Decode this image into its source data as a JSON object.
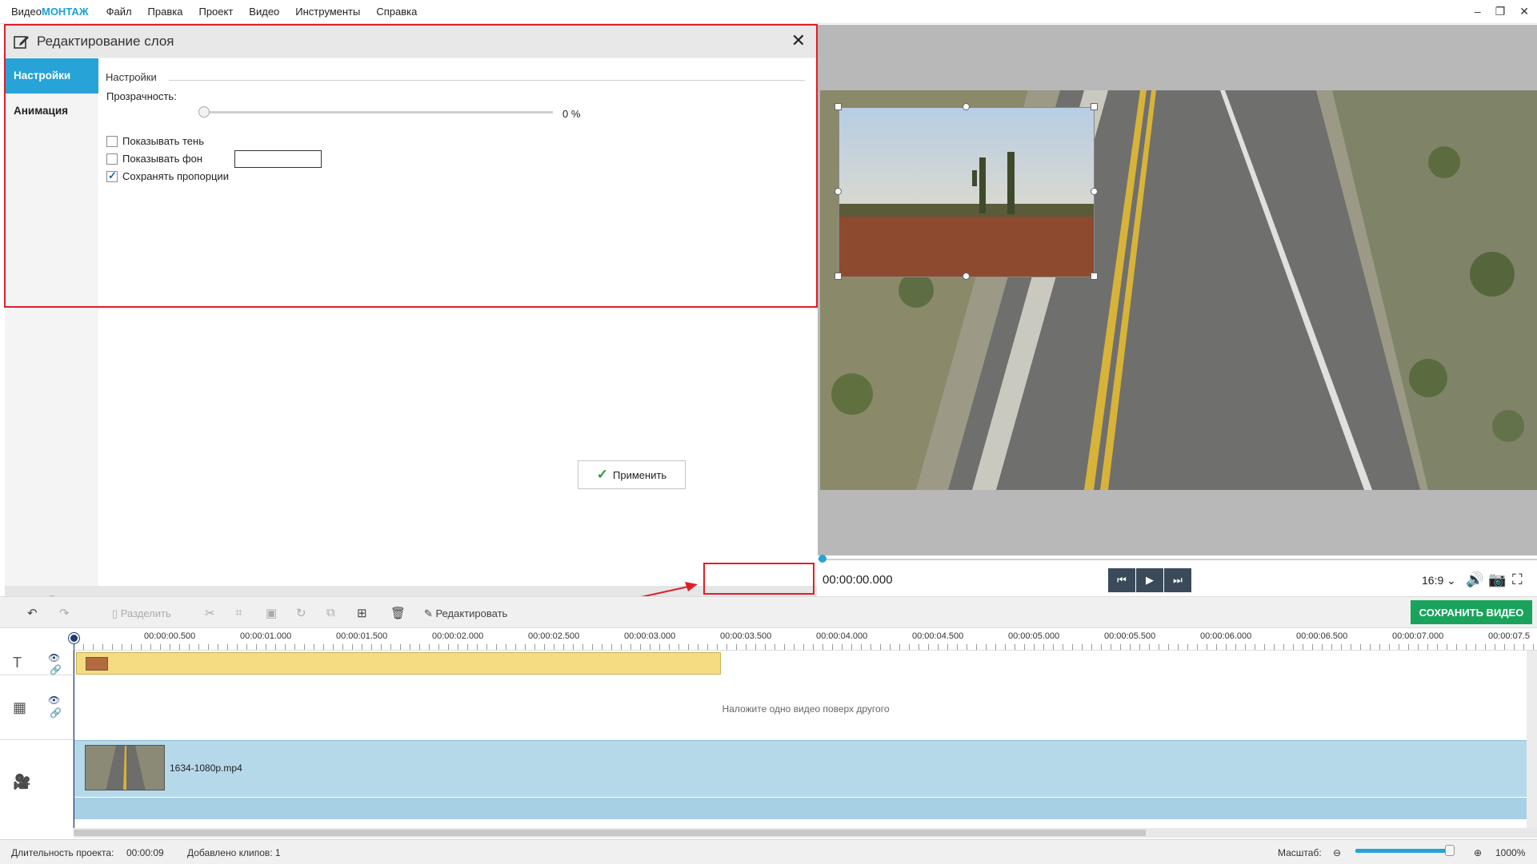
{
  "app": {
    "logo_prefix": "Видео",
    "logo_brand": "МОНТАЖ"
  },
  "menu": [
    "Файл",
    "Правка",
    "Проект",
    "Видео",
    "Инструменты",
    "Справка"
  ],
  "window_controls": [
    "minimize",
    "restore",
    "close"
  ],
  "editor": {
    "title": "Редактирование слоя",
    "tabs": [
      {
        "label": "Настройки",
        "active": true
      },
      {
        "label": "Анимация",
        "active": false
      }
    ],
    "section": "Настройки",
    "opacity_label": "Прозрачность:",
    "opacity_value": "0 %",
    "opacity_level": 0,
    "show_shadow": {
      "label": "Показывать тень",
      "checked": false
    },
    "show_background": {
      "label": "Показывать фон",
      "checked": false
    },
    "keep_proportions": {
      "label": "Сохранять пропорции",
      "checked": true
    },
    "apply_label": "Применить"
  },
  "player": {
    "timecode": "00:00:00.000",
    "aspect": "16:9 ⌄"
  },
  "toolbar": {
    "split_label": "Разделить",
    "edit_label": "Редактировать",
    "save_label": "СОХРАНИТЬ ВИДЕО"
  },
  "timeline": {
    "ticks": [
      "00:00:00.500",
      "00:00:01.000",
      "00:00:01.500",
      "00:00:02.000",
      "00:00:02.500",
      "00:00:03.000",
      "00:00:03.500",
      "00:00:04.000",
      "00:00:04.500",
      "00:00:05.000",
      "00:00:05.500",
      "00:00:06.000",
      "00:00:06.500",
      "00:00:07.000",
      "00:00:07.5"
    ],
    "overlay_hint": "Наложите одно видео поверх другого",
    "clip_name": "1634-1080p.mp4"
  },
  "status": {
    "duration_label": "Длительность проекта:",
    "duration_value": "00:00:09",
    "clips_label": "Добавлено клипов: 1",
    "zoom_label": "Масштаб:",
    "zoom_value": "1000%"
  },
  "colors": {
    "accent": "#27a3d7",
    "save": "#1aa35b",
    "highlight": "#e01e2a",
    "text_clip": "#f5dc82",
    "video_track": "#b6d9ea"
  }
}
